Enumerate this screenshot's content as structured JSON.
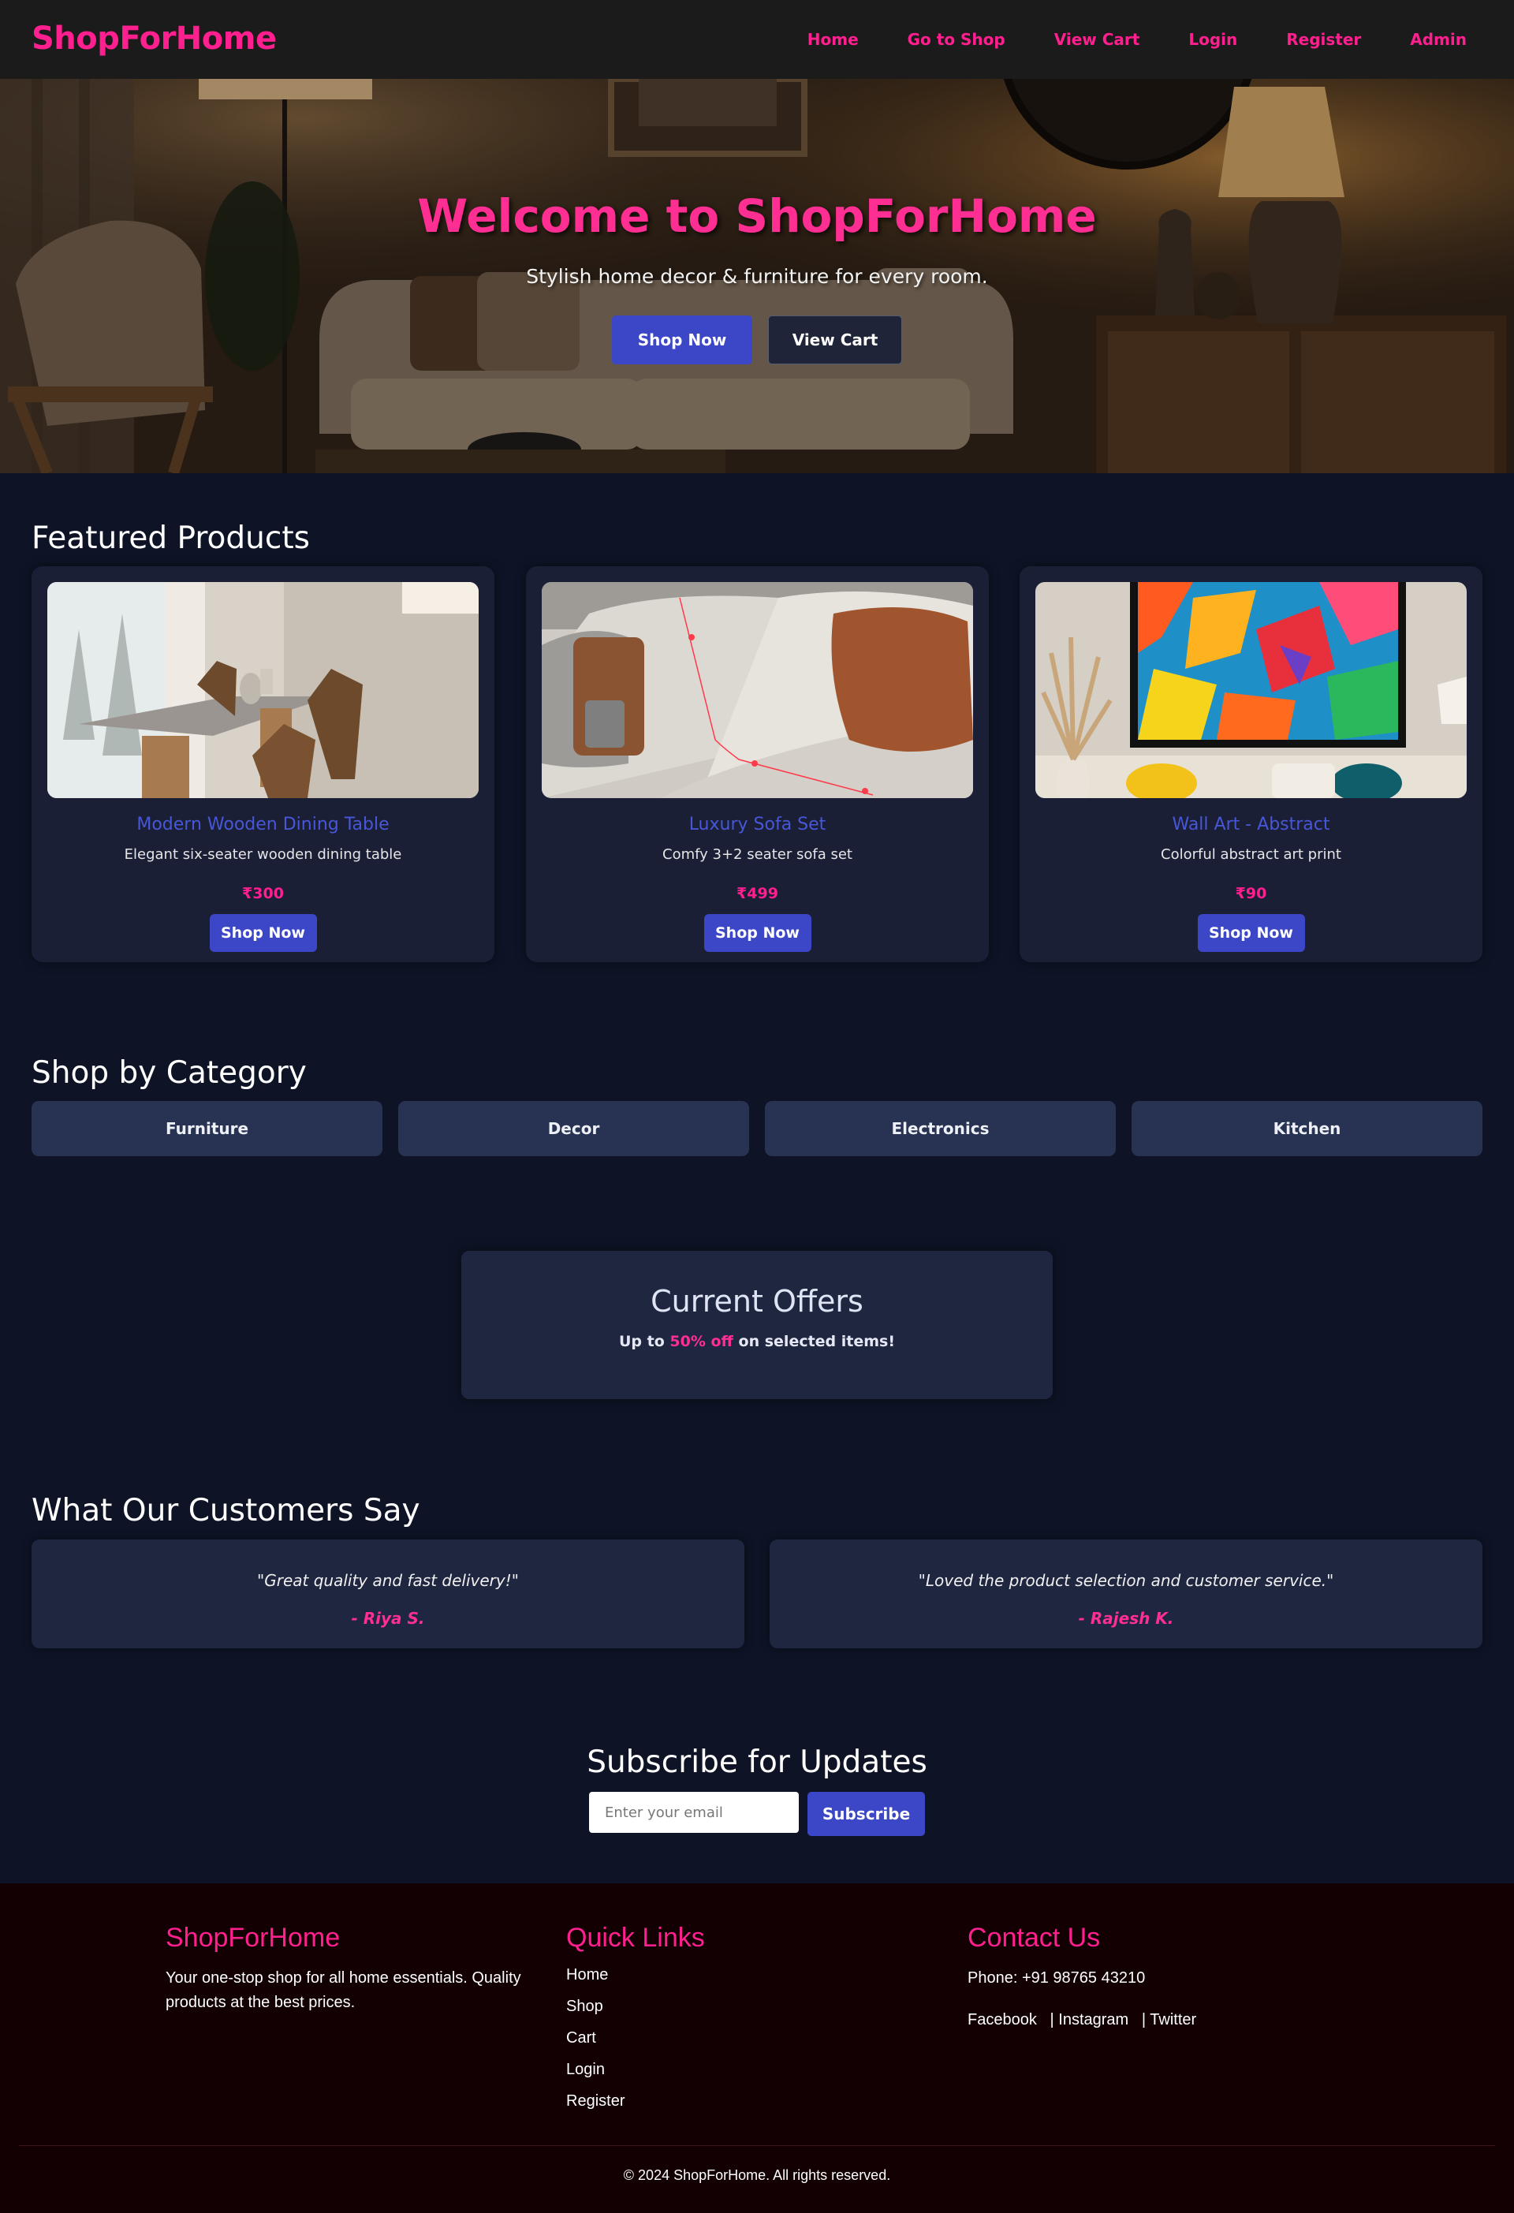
{
  "colors": {
    "accent_pink": "#ff1f8e",
    "primary_blue": "#3b47c7",
    "page_bg": "#0e1426",
    "card_bg": "#1a1f36",
    "footer_bg": "#120002"
  },
  "nav": {
    "brand": "ShopForHome",
    "links": [
      "Home",
      "Go to Shop",
      "View Cart",
      "Login",
      "Register",
      "Admin"
    ]
  },
  "hero": {
    "title": "Welcome to ShopForHome",
    "subtitle": "Stylish home decor & furniture for every room.",
    "primary_button": "Shop Now",
    "secondary_button": "View Cart"
  },
  "featured": {
    "title": "Featured Products",
    "products": [
      {
        "name": "Modern Wooden Dining Table",
        "description": "Elegant six-seater wooden dining table",
        "price": "₹300",
        "button": "Shop Now",
        "image": "dining-table-image"
      },
      {
        "name": "Luxury Sofa Set",
        "description": "Comfy 3+2 seater sofa set",
        "price": "₹499",
        "button": "Shop Now",
        "image": "sofa-image"
      },
      {
        "name": "Wall Art - Abstract",
        "description": "Colorful abstract art print",
        "price": "₹90",
        "button": "Shop Now",
        "image": "wall-art-image"
      }
    ]
  },
  "categories": {
    "title": "Shop by Category",
    "items": [
      "Furniture",
      "Decor",
      "Electronics",
      "Kitchen"
    ]
  },
  "offers": {
    "title": "Current Offers",
    "text_before": "Up to ",
    "highlight": "50% off",
    "text_after": " on selected items!"
  },
  "testimonials": {
    "title": "What Our Customers Say",
    "items": [
      {
        "quote": "\"Great quality and fast delivery!\"",
        "author": "- Riya S."
      },
      {
        "quote": "\"Loved the product selection and customer service.\"",
        "author": "- Rajesh K."
      }
    ]
  },
  "subscribe": {
    "title": "Subscribe for Updates",
    "placeholder": "Enter your email",
    "value": "",
    "button": "Subscribe"
  },
  "footer": {
    "brand": "ShopForHome",
    "about": "Your one-stop shop for all home essentials. Quality products at the best prices.",
    "links_title": "Quick Links",
    "links": [
      "Home",
      "Shop",
      "Cart",
      "Login",
      "Register"
    ],
    "contact_title": "Contact Us",
    "phone": "Phone: +91 98765 43210",
    "social": [
      "Facebook",
      "| Instagram",
      "| Twitter"
    ],
    "copyright": "© 2024 ShopForHome. All rights reserved."
  }
}
